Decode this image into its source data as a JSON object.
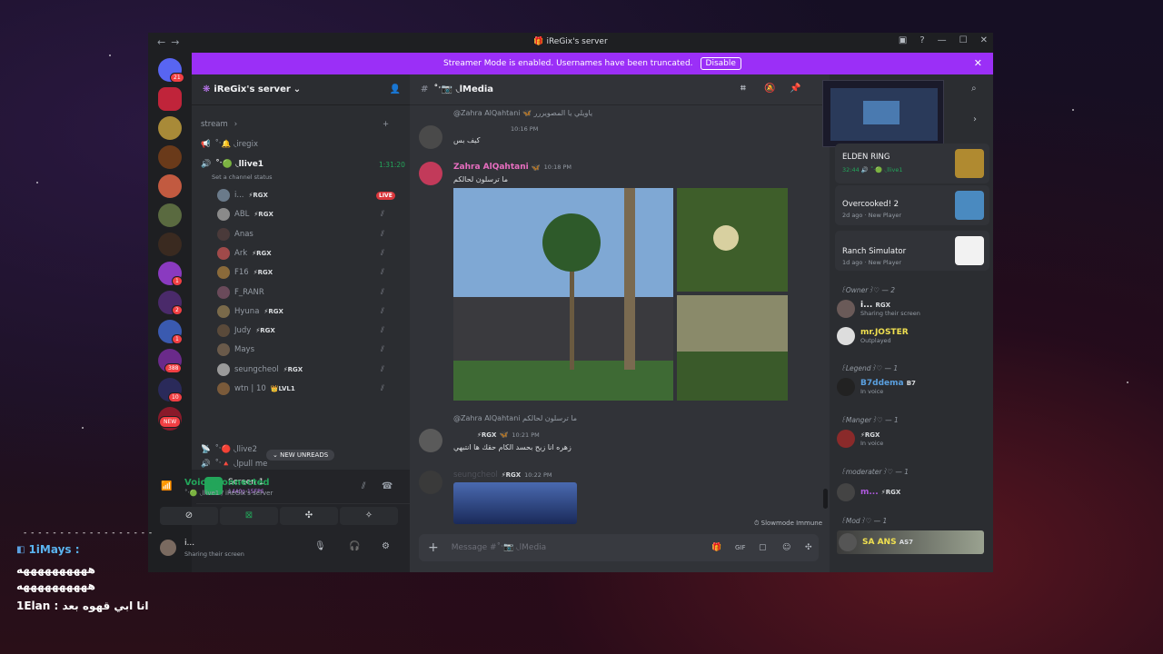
{
  "window": {
    "title": "iReGix's server",
    "title_icon": "server-icon"
  },
  "banner": {
    "text": "Streamer Mode is enabled. Usernames have been truncated.",
    "button": "Disable"
  },
  "servers": {
    "badges": [
      "21",
      "1",
      "2",
      "1",
      "388",
      "10",
      "NEW"
    ]
  },
  "channels": {
    "server_name": "iReGix's server",
    "category": "stream",
    "items": [
      {
        "name": "˚ˑ🔔 ◟iregix"
      },
      {
        "name": "˚ˑ🟢 ◟llive1",
        "timer": "1:31:20",
        "status": "Set a channel status"
      }
    ],
    "voice_users": [
      {
        "name": "i...",
        "tag": "⚡RGX",
        "live": "LIVE"
      },
      {
        "name": "ABL",
        "tag": "⚡RGX"
      },
      {
        "name": "Anas",
        "tag": ""
      },
      {
        "name": "Ark",
        "tag": "⚡RGX"
      },
      {
        "name": "F16",
        "tag": "⚡RGX"
      },
      {
        "name": "F_RANR",
        "tag": ""
      },
      {
        "name": "Hyuna",
        "tag": "⚡RGX"
      },
      {
        "name": "Judy",
        "tag": "⚡RGX"
      },
      {
        "name": "Mays",
        "tag": ""
      },
      {
        "name": "seungcheol",
        "tag": "⚡RGX"
      },
      {
        "name": "wtn | 10",
        "tag": "👑LVL1"
      }
    ],
    "more": [
      {
        "name": "˚ˑ🔴 ◟llive2"
      },
      {
        "name": "˚ˑ🔺 ◟lpull me"
      }
    ],
    "new_unreads": "NEW UNREADS"
  },
  "voice_panel": {
    "screen_title": "Screen 1",
    "screen_sub": "1440p 15FPS",
    "connected": "Voice Connected",
    "connected_sub": "˚ˑ🟢 ◟llive1 / iReGix's server",
    "user_name": "i...",
    "user_status": "Sharing their screen"
  },
  "chat": {
    "channel": "˚ˑ📷 ◟lMedia",
    "messages": [
      {
        "reply": "@Zahra AlQahtani 🦋 ياويلي يا المصويررر",
        "time": "10:16 PM",
        "text": "كيف بس"
      },
      {
        "name": "Zahra AlQahtani",
        "time": "10:18 PM",
        "text": "ما ترسلون لحالكم"
      },
      {
        "reply": "@Zahra AlQahtani ما ترسلون لحالكم",
        "tag": "⚡RGX",
        "time": "10:21 PM",
        "text": "زهره انا زيح بحسد الكام حقك ها انتبهي"
      },
      {
        "name": "seungcheol",
        "tag": "⚡RGX",
        "time": "10:22 PM"
      }
    ],
    "slowmode": "Slowmode Immune",
    "input_placeholder": "Message #˚ˑ📷 ◟lMedia"
  },
  "members": {
    "activities": [
      {
        "game": "ELDEN RING",
        "sub": "32:44 🔊 ˚ˑ🟢 ◟llive1"
      },
      {
        "game": "Overcooked! 2",
        "sub": "2d ago · New Player"
      },
      {
        "game": "Ranch Simulator",
        "sub": "1d ago · New Player"
      }
    ],
    "groups": [
      {
        "title": "꒰Owner꒱♡ — 2",
        "members": [
          {
            "name": "i...",
            "tag": "RGX",
            "status": "Sharing their screen"
          },
          {
            "name": "mr.JOSTER",
            "status": "Outplayed"
          }
        ]
      },
      {
        "title": "꒰Legend꒱♡ — 1",
        "members": [
          {
            "name": "B7ddema",
            "tag": "B7",
            "status": "In voice"
          }
        ]
      },
      {
        "title": "꒰Manger꒱♡ — 1",
        "members": [
          {
            "name": "",
            "tag": "⚡RGX",
            "status": "In voice"
          }
        ]
      },
      {
        "title": "꒰moderater꒱♡ — 1",
        "members": [
          {
            "name": "m...",
            "tag": "⚡RGX"
          }
        ]
      },
      {
        "title": "꒰Mod꒱♡ — 1",
        "members": [
          {
            "name": "SA ANS",
            "tag": "AS7"
          }
        ]
      }
    ]
  },
  "overlay": {
    "line1": "1iMays :",
    "line2": "ههههههههههه",
    "line3": "ههههههههههه",
    "line4": "1Elan : انا ابي قهوه بعد"
  },
  "colors": {
    "accent": "#9b2ff7",
    "green": "#23a55a",
    "red": "#f23f43",
    "bg": "#313338"
  }
}
